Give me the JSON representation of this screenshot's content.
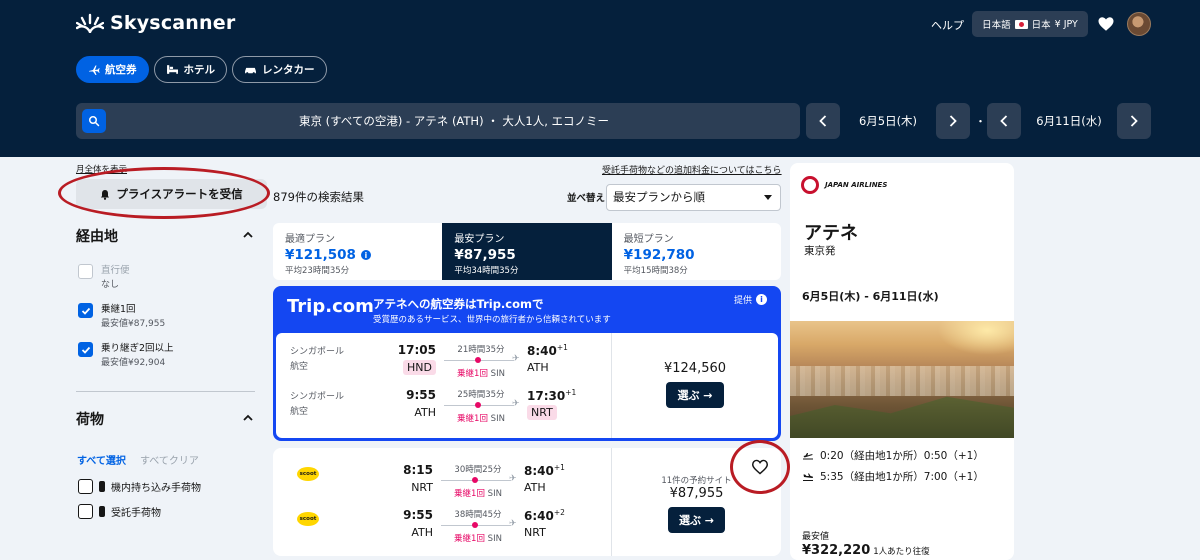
{
  "header": {
    "logo_text": "Skyscanner",
    "help": "ヘルプ",
    "locale": {
      "language": "日本語",
      "country": "日本",
      "currency": "¥ JPY"
    },
    "tabs": [
      {
        "label": "航空券",
        "icon": "plane-icon",
        "active": true
      },
      {
        "label": "ホテル",
        "icon": "bed-icon",
        "active": false
      },
      {
        "label": "レンタカー",
        "icon": "car-icon",
        "active": false
      }
    ],
    "search": {
      "summary": "東京 (すべての空港) - アテネ (ATH) ・ 大人1人, エコノミー",
      "depart_date": "6月5日(木)",
      "return_date": "6月11日(水)",
      "separator": "・"
    }
  },
  "sidebar": {
    "month_link": "月全体を表示",
    "price_alert": "プライスアラートを受信",
    "stops": {
      "title": "経由地",
      "options": [
        {
          "label": "直行便",
          "sub": "なし",
          "checked": false,
          "disabled": true
        },
        {
          "label": "乗継1回",
          "sub": "最安値¥87,955",
          "checked": true,
          "disabled": false
        },
        {
          "label": "乗り継ぎ2回以上",
          "sub": "最安値¥92,904",
          "checked": true,
          "disabled": false
        }
      ]
    },
    "baggage": {
      "title": "荷物",
      "select_all": "すべて選択",
      "clear_all": "すべてクリア",
      "options": [
        {
          "label": "機内持ち込み手荷物",
          "checked": false
        },
        {
          "label": "受託手荷物",
          "checked": false
        }
      ]
    }
  },
  "results": {
    "count": "879件の検索結果",
    "fee_link": "受託手荷物などの追加料金についてはこちら",
    "sort_label": "並べ替え",
    "sort_value": "最安プランから順",
    "summary_tabs": [
      {
        "label": "最適プラン",
        "price": "¥121,508",
        "duration": "平均23時間35分",
        "active": false,
        "info": true
      },
      {
        "label": "最安プラン",
        "price": "¥87,955",
        "duration": "平均34時間35分",
        "active": true,
        "info": false
      },
      {
        "label": "最短プラン",
        "price": "¥192,780",
        "duration": "平均15時間38分",
        "active": false,
        "info": false
      }
    ],
    "promo": {
      "brand": "Trip.com",
      "title": "アテネへの航空券はTrip.comで",
      "subtitle": "受賞歴のあるサービス、世界中の旅行者から信頼されています",
      "sponsor": "提供",
      "price": "¥124,560",
      "button": "選ぶ →",
      "legs": [
        {
          "airline": "シンガポール航空",
          "dep_time": "17:05",
          "dep_code": "HND",
          "duration": "21時間35分",
          "stops": "乗継1回",
          "via": "SIN",
          "arr_time": "8:40",
          "arr_offset": "+1",
          "arr_code": "ATH"
        },
        {
          "airline": "シンガポール航空",
          "dep_time": "9:55",
          "dep_code": "ATH",
          "duration": "25時間35分",
          "stops": "乗継1回",
          "via": "SIN",
          "arr_time": "17:30",
          "arr_offset": "+1",
          "arr_code": "NRT"
        }
      ]
    },
    "card": {
      "sites": "11件の予約サイト",
      "price": "¥87,955",
      "button": "選ぶ →",
      "legs": [
        {
          "airline_logo": "scoot",
          "dep_time": "8:15",
          "dep_code": "NRT",
          "duration": "30時間25分",
          "stops": "乗継1回",
          "via": "SIN",
          "arr_time": "8:40",
          "arr_offset": "+1",
          "arr_code": "ATH"
        },
        {
          "airline_logo": "scoot",
          "dep_time": "9:55",
          "dep_code": "ATH",
          "duration": "38時間45分",
          "stops": "乗継1回",
          "via": "SIN",
          "arr_time": "6:40",
          "arr_offset": "+2",
          "arr_code": "NRT"
        }
      ]
    }
  },
  "ad": {
    "airline_logo": "JAPAN AIRLINES",
    "destination": "アテネ",
    "origin": "東京発",
    "dates": "6月5日(木) - 6月11日(水)",
    "flights": [
      {
        "icon": "takeoff-icon",
        "text": "0:20（経由地1か所）0:50（+1）"
      },
      {
        "icon": "landing-icon",
        "text": "5:35（経由地1か所）7:00（+1）"
      }
    ],
    "lowest_label": "最安値",
    "price": "¥322,220",
    "per": "1人あたり往復"
  },
  "colors": {
    "header_bg": "#05203c",
    "accent": "#0062e3",
    "promo_bg": "#1447f2",
    "stop_pink": "#e70866",
    "annotation_red": "#b91c24"
  }
}
